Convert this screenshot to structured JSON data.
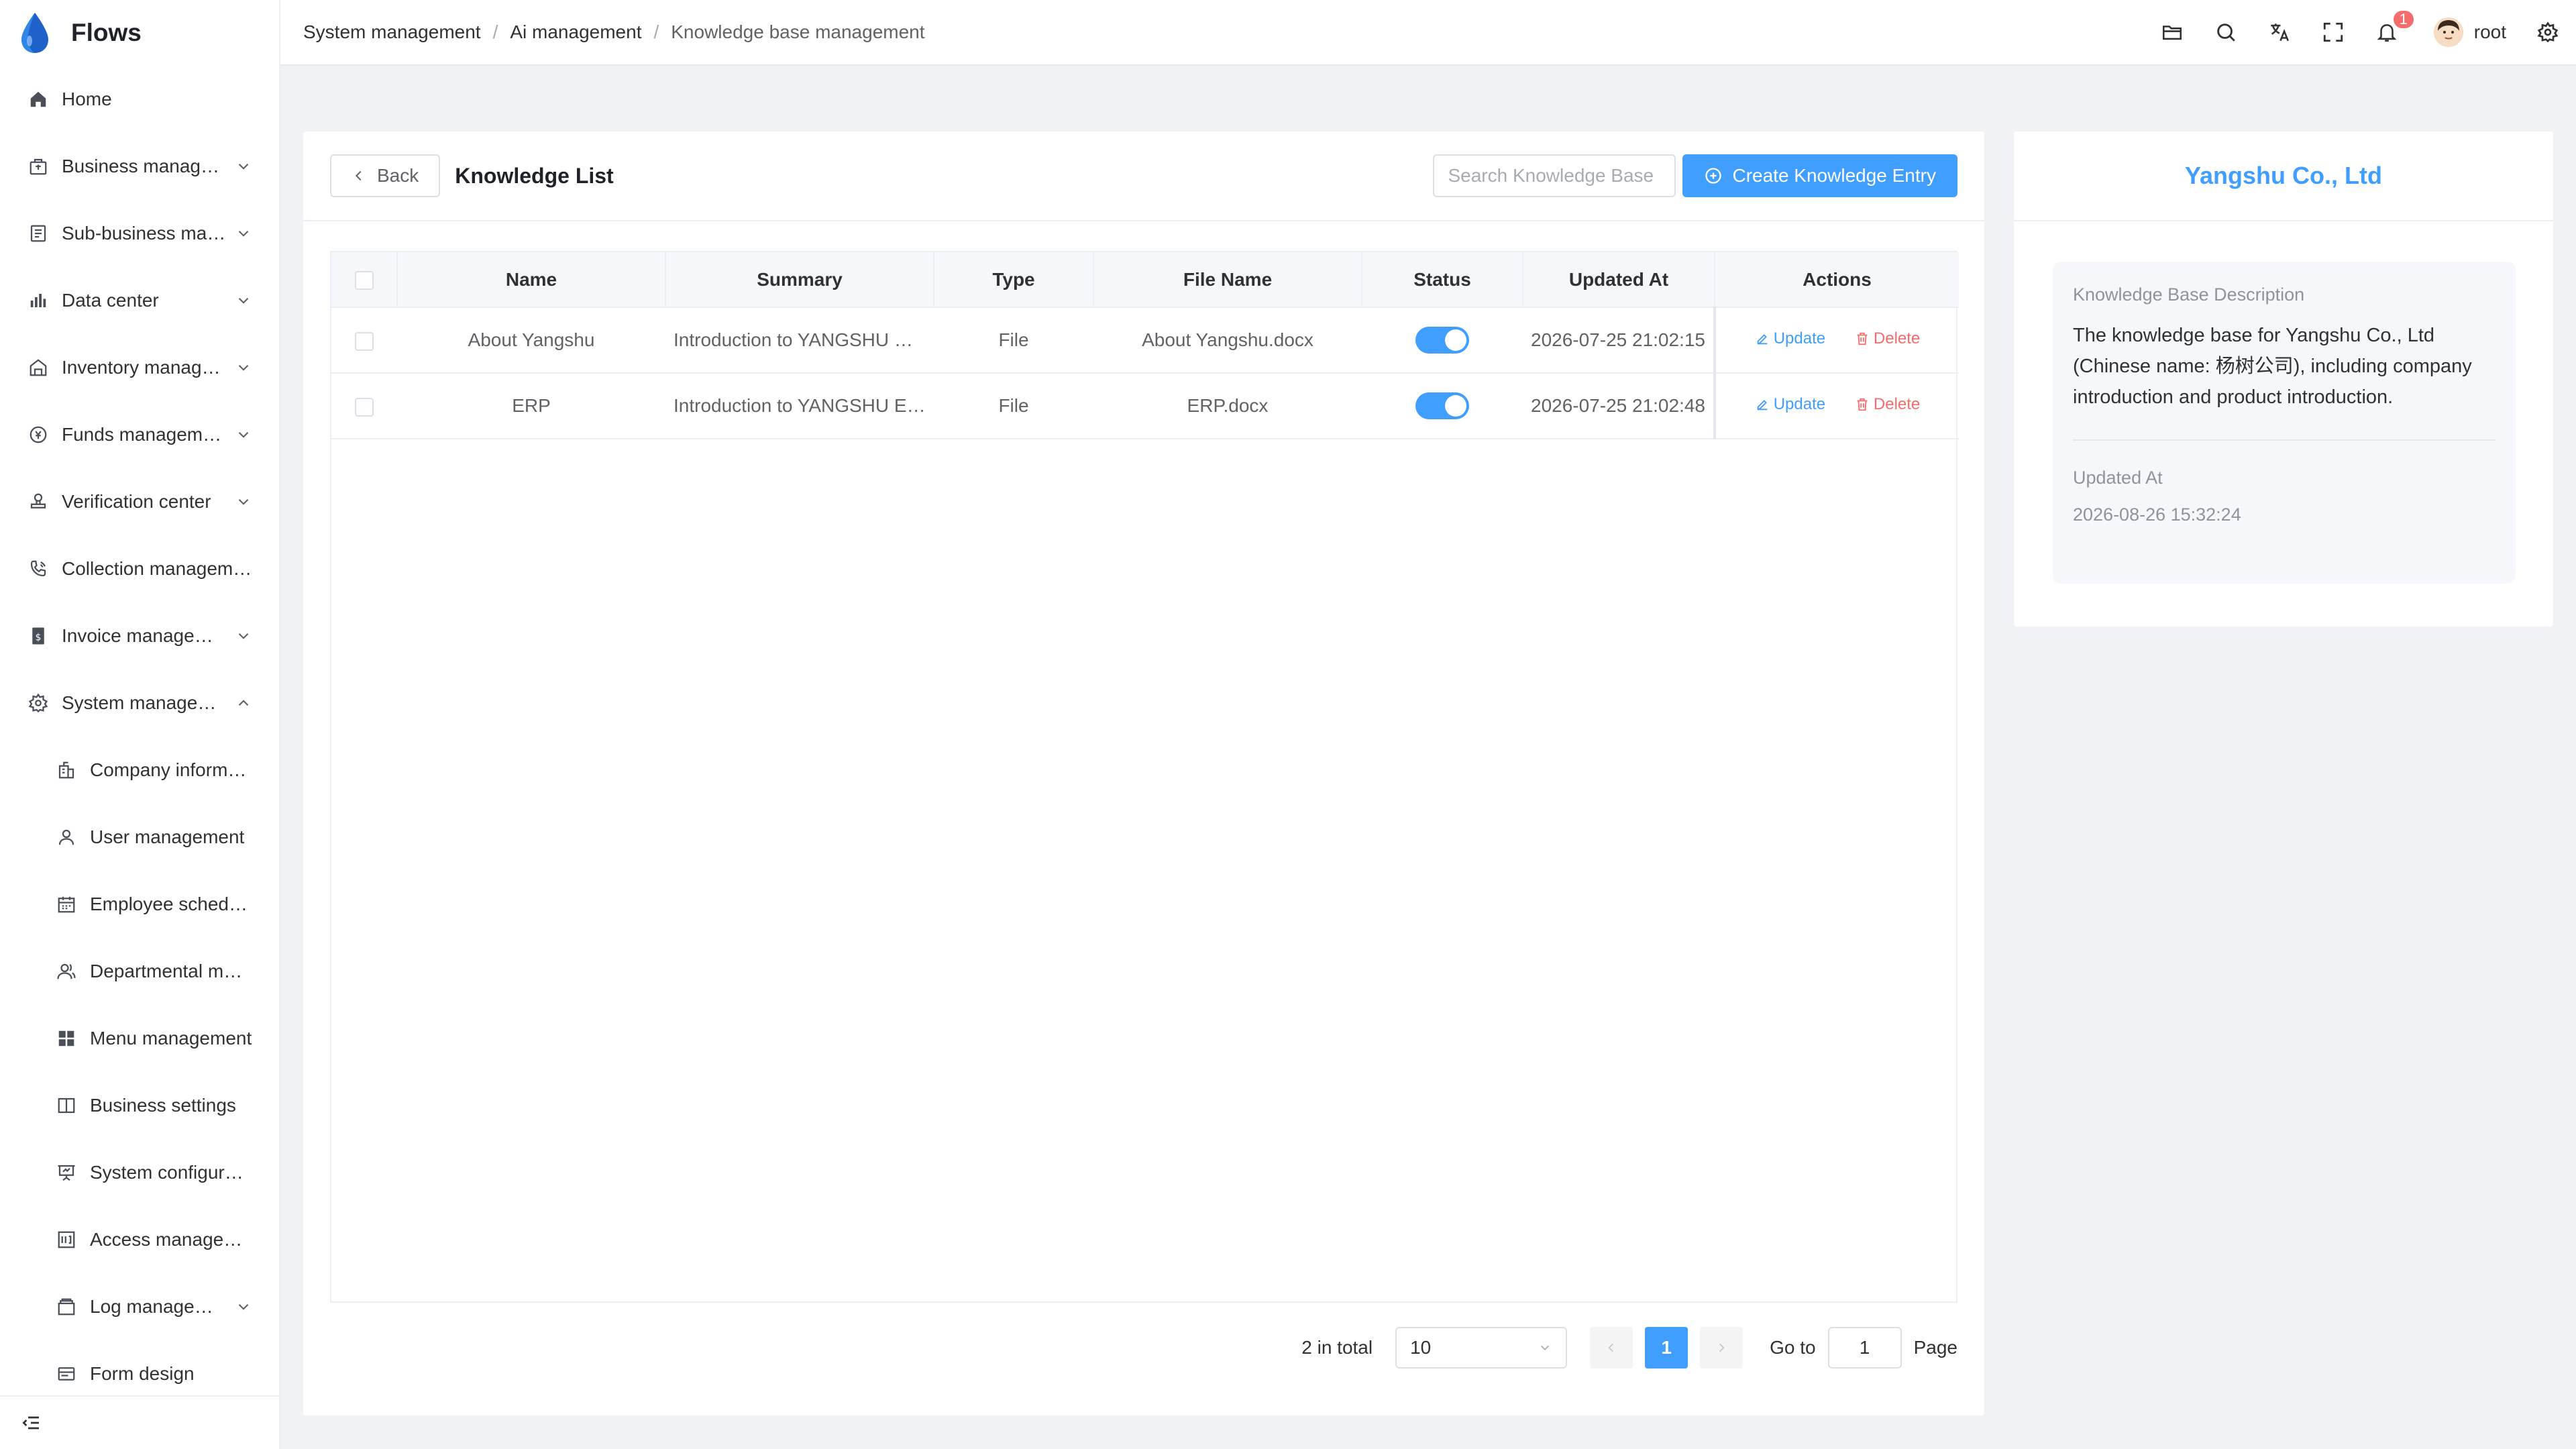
{
  "app": {
    "title": "Flows"
  },
  "sidebar": {
    "items": [
      {
        "label": "Home",
        "icon": "home-icon",
        "has_children": false
      },
      {
        "label": "Business management",
        "icon": "business-bag-icon",
        "has_children": true
      },
      {
        "label": "Sub-business management",
        "icon": "document-list-icon",
        "has_children": true
      },
      {
        "label": "Data center",
        "icon": "bar-chart-icon",
        "has_children": true
      },
      {
        "label": "Inventory management",
        "icon": "warehouse-icon",
        "has_children": true
      },
      {
        "label": "Funds management",
        "icon": "coin-icon",
        "has_children": true
      },
      {
        "label": "Verification center",
        "icon": "stamp-icon",
        "has_children": true
      },
      {
        "label": "Collection management",
        "icon": "phone-call-icon",
        "has_children": false
      },
      {
        "label": "Invoice management",
        "icon": "invoice-icon",
        "has_children": true
      },
      {
        "label": "System management",
        "icon": "gear-icon",
        "has_children": true,
        "expanded": true
      }
    ],
    "sub_items": [
      {
        "label": "Company information",
        "icon": "building-icon"
      },
      {
        "label": "User management",
        "icon": "user-icon"
      },
      {
        "label": "Employee schedule",
        "icon": "calendar-icon"
      },
      {
        "label": "Departmental management",
        "icon": "users-icon"
      },
      {
        "label": "Menu management",
        "icon": "grid-icon"
      },
      {
        "label": "Business settings",
        "icon": "book-icon"
      },
      {
        "label": "System configuration",
        "icon": "presentation-icon"
      },
      {
        "label": "Access management",
        "icon": "access-icon"
      },
      {
        "label": "Log management",
        "icon": "log-icon",
        "has_children": true
      },
      {
        "label": "Form design",
        "icon": "form-icon"
      }
    ]
  },
  "header": {
    "breadcrumb": [
      "System management",
      "Ai management",
      "Knowledge base management"
    ],
    "notification_count": "1",
    "username": "root"
  },
  "main": {
    "back_label": "Back",
    "title": "Knowledge List",
    "search_placeholder": "Search Knowledge Base",
    "create_label": "Create Knowledge Entry",
    "columns": [
      "Name",
      "Summary",
      "Type",
      "File Name",
      "Status",
      "Updated At",
      "Actions"
    ],
    "rows": [
      {
        "name": "About Yangshu",
        "summary": "Introduction to YANGSHU Company",
        "type": "File",
        "file_name": "About Yangshu.docx",
        "status": true,
        "updated_at": "2026-07-25 21:02:15",
        "update": "Update",
        "delete": "Delete"
      },
      {
        "name": "ERP",
        "summary": "Introduction to YANGSHU ERP",
        "type": "File",
        "file_name": "ERP.docx",
        "status": true,
        "updated_at": "2026-07-25 21:02:48",
        "update": "Update",
        "delete": "Delete"
      }
    ],
    "pagination": {
      "total_text": "2 in total",
      "page_size": "10",
      "current_page": "1",
      "goto_label": "Go to",
      "goto_value": "1",
      "page_label": "Page"
    }
  },
  "side": {
    "title": "Yangshu Co., Ltd",
    "desc_label": "Knowledge Base Description",
    "description": "The knowledge base for Yangshu Co., Ltd (Chinese name: 杨树公司), including company introduction and product introduction.",
    "updated_label": "Updated At",
    "updated_value": "2026-08-26 15:32:24"
  },
  "colors": {
    "primary": "#409eff",
    "danger": "#f56c6c",
    "background": "#f0f2f5"
  }
}
